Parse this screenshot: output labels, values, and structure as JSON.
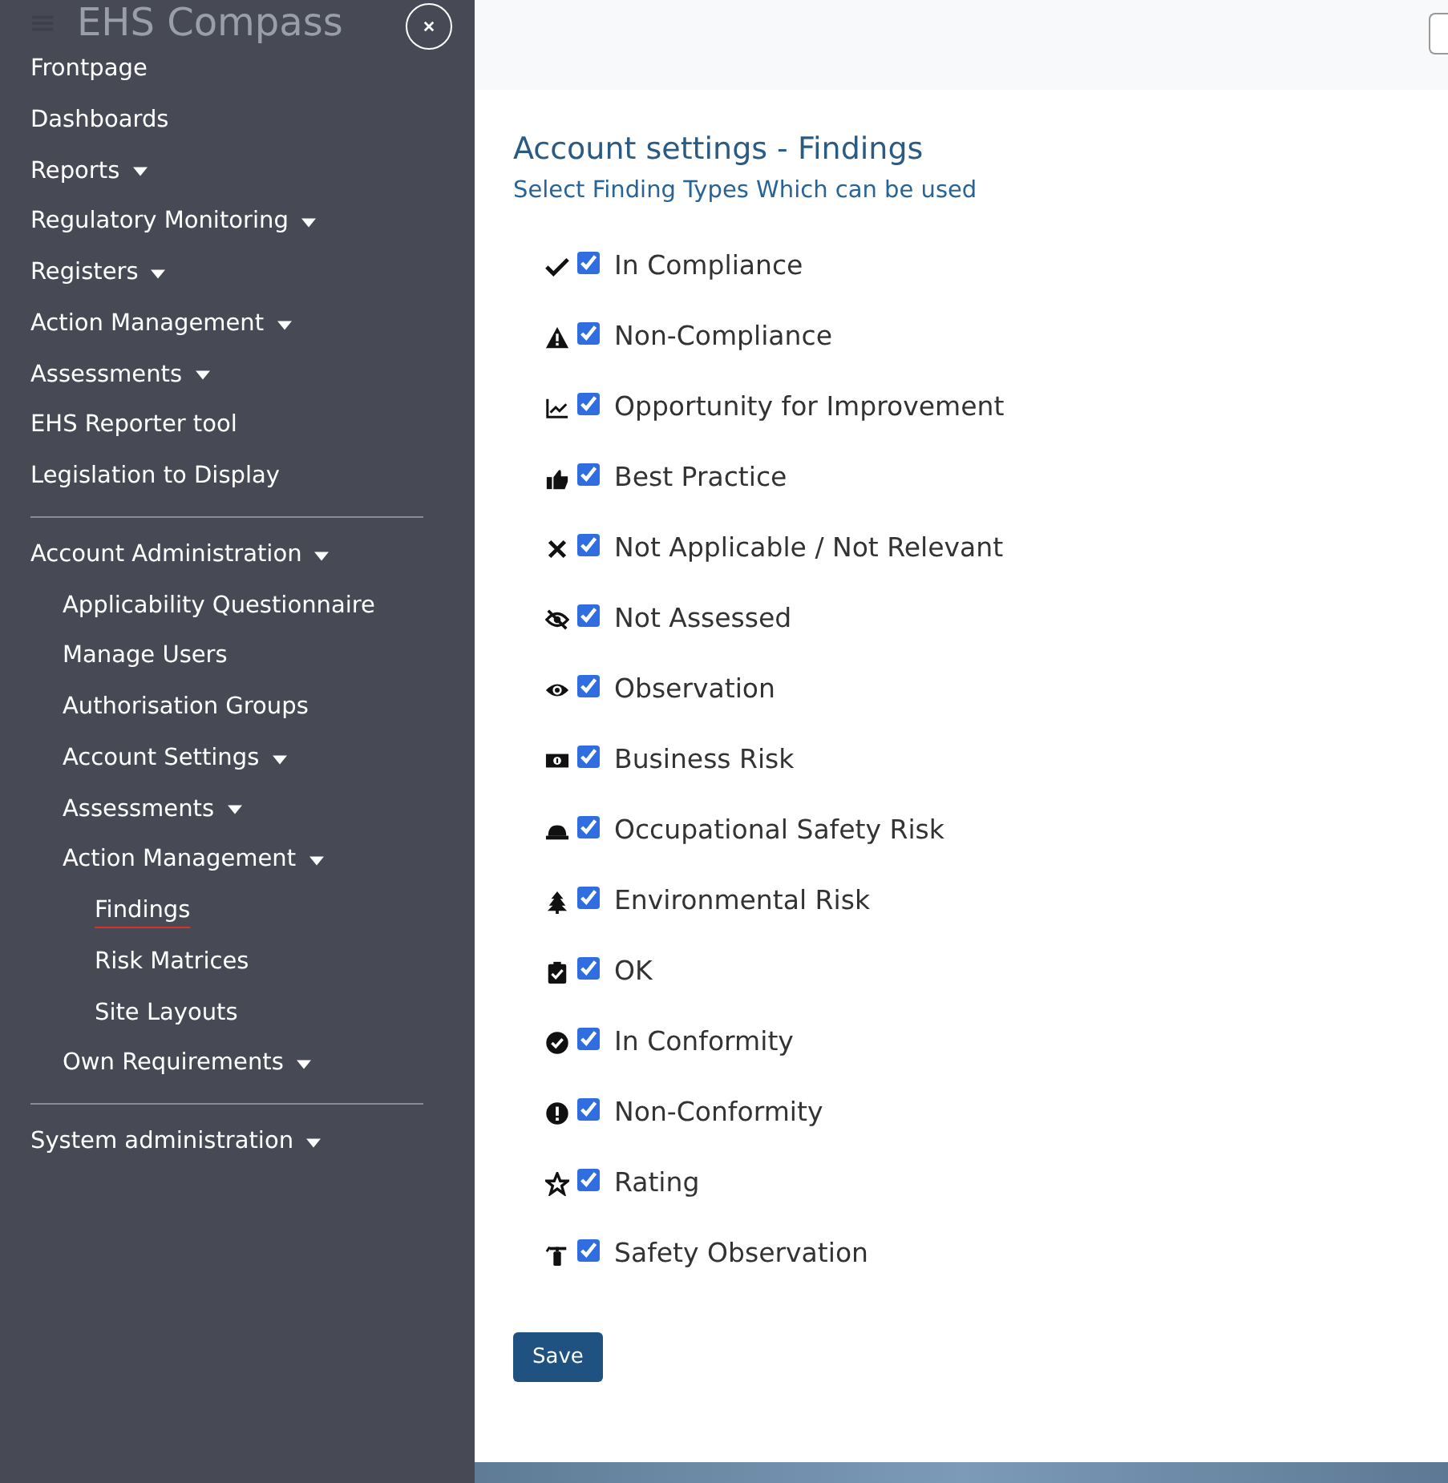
{
  "header": {
    "title": "EHS Compass"
  },
  "sidebar": {
    "groups": [
      [
        {
          "label": "Frontpage",
          "dropdown": false,
          "selected": false
        },
        {
          "label": "Dashboards",
          "dropdown": false,
          "selected": false
        },
        {
          "label": "Reports",
          "dropdown": true,
          "selected": false
        },
        {
          "label": "Regulatory Monitoring",
          "dropdown": true,
          "selected": false
        },
        {
          "label": "Registers",
          "dropdown": true,
          "selected": false
        },
        {
          "label": "Action Management",
          "dropdown": true,
          "selected": false
        },
        {
          "label": "Assessments",
          "dropdown": true,
          "selected": false
        },
        {
          "label": "EHS Reporter tool",
          "dropdown": false,
          "selected": false
        },
        {
          "label": "Legislation to Display",
          "dropdown": false,
          "selected": false
        }
      ],
      [
        {
          "label": "Account Administration",
          "dropdown": true,
          "selected": false,
          "children": [
            {
              "label": "Applicability Questionnaire",
              "dropdown": false,
              "selected": false
            },
            {
              "label": "Manage Users",
              "dropdown": false,
              "selected": false
            },
            {
              "label": "Authorisation Groups",
              "dropdown": false,
              "selected": false
            },
            {
              "label": "Account Settings",
              "dropdown": true,
              "selected": false
            },
            {
              "label": "Assessments",
              "dropdown": true,
              "selected": false
            },
            {
              "label": "Action Management",
              "dropdown": true,
              "selected": false,
              "children": [
                {
                  "label": "Findings",
                  "dropdown": false,
                  "selected": true
                },
                {
                  "label": "Risk Matrices",
                  "dropdown": false,
                  "selected": false
                },
                {
                  "label": "Site Layouts",
                  "dropdown": false,
                  "selected": false
                }
              ]
            },
            {
              "label": "Own Requirements",
              "dropdown": true,
              "selected": false
            }
          ]
        }
      ],
      [
        {
          "label": "System administration",
          "dropdown": true,
          "selected": false
        }
      ]
    ]
  },
  "content": {
    "title": "Account settings - Findings",
    "subtitle": "Select Finding Types Which can be used",
    "finding_types": [
      {
        "label": "In Compliance",
        "checked": true
      },
      {
        "label": "Non-Compliance",
        "checked": true
      },
      {
        "label": "Opportunity for Improvement",
        "checked": true
      },
      {
        "label": "Best Practice",
        "checked": true
      },
      {
        "label": "Not Applicable / Not Relevant",
        "checked": true
      },
      {
        "label": "Not Assessed",
        "checked": true
      },
      {
        "label": "Observation",
        "checked": true
      },
      {
        "label": "Business Risk",
        "checked": true
      },
      {
        "label": "Occupational Safety Risk",
        "checked": true
      },
      {
        "label": "Environmental Risk",
        "checked": true
      },
      {
        "label": "OK",
        "checked": true
      },
      {
        "label": "In Conformity",
        "checked": true
      },
      {
        "label": "Non-Conformity",
        "checked": true
      },
      {
        "label": "Rating",
        "checked": true
      },
      {
        "label": "Safety Observation",
        "checked": true
      }
    ],
    "save_button": "Save"
  }
}
